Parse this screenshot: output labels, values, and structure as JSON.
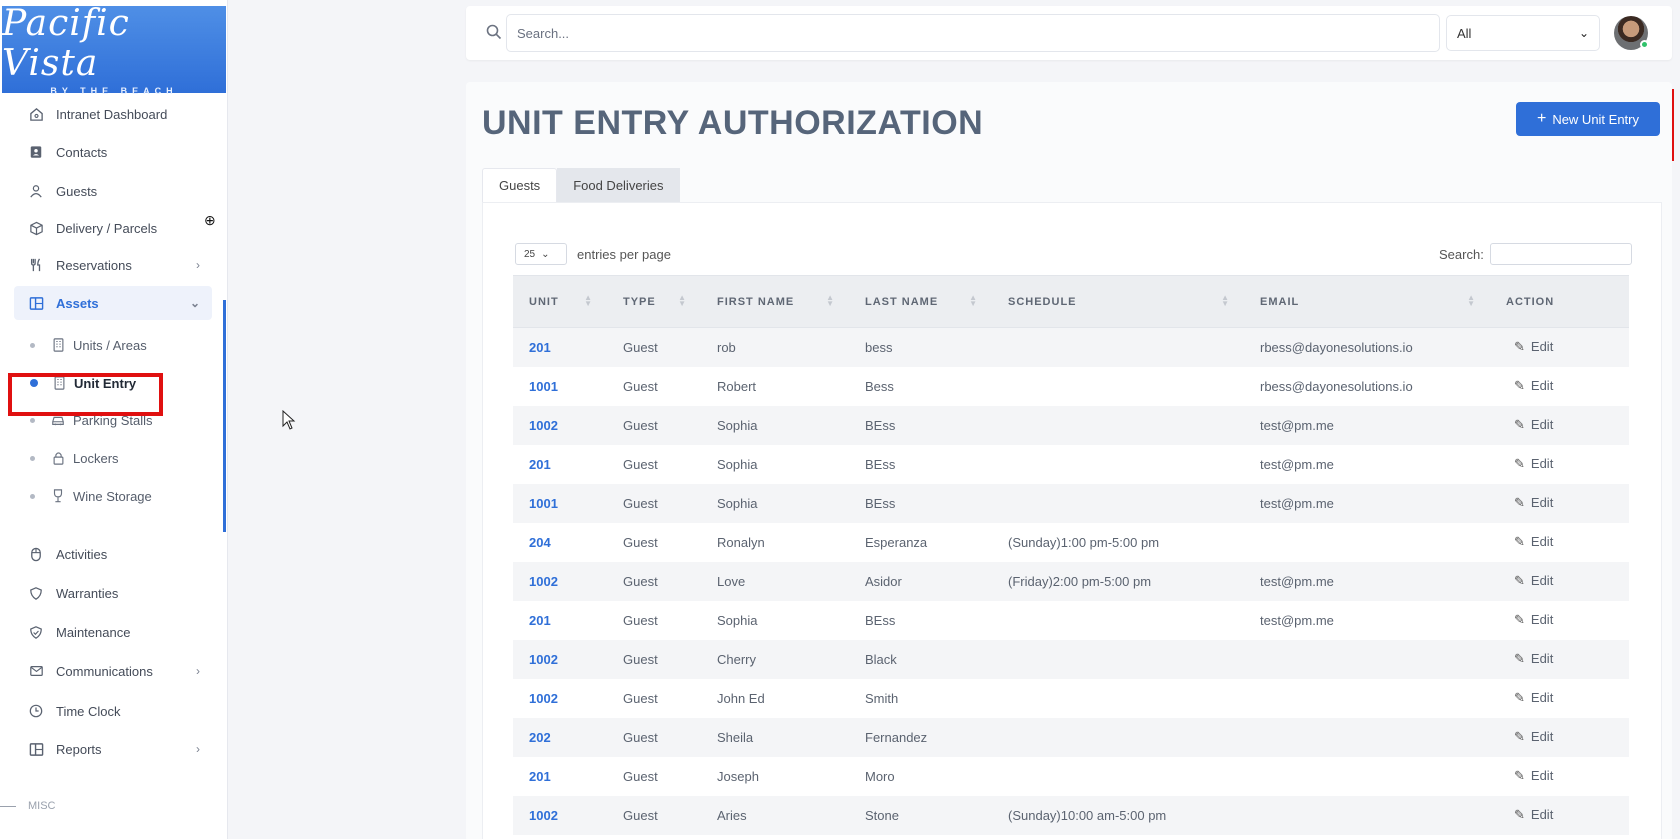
{
  "logo": {
    "script": "Pacific Vista",
    "tagline": "BY THE BEACH"
  },
  "sidebar": {
    "items": [
      {
        "label": "Intranet Dashboard",
        "icon": "home-icon"
      },
      {
        "label": "Contacts",
        "icon": "contacts-icon"
      },
      {
        "label": "Guests",
        "icon": "user-icon"
      },
      {
        "label": "Delivery / Parcels",
        "icon": "package-icon"
      },
      {
        "label": "Reservations",
        "icon": "utensils-icon",
        "chevron": "›"
      },
      {
        "label": "Assets",
        "icon": "layout-icon",
        "chevron": "⌄"
      }
    ],
    "sub_items": [
      {
        "label": "Units / Areas",
        "icon": "building-icon"
      },
      {
        "label": "Unit Entry",
        "icon": "building-icon"
      },
      {
        "label": "Parking Stalls",
        "icon": "car-icon"
      },
      {
        "label": "Lockers",
        "icon": "lock-icon"
      },
      {
        "label": "Wine Storage",
        "icon": "wine-icon"
      }
    ],
    "items_bottom": [
      {
        "label": "Activities",
        "icon": "mouse-icon"
      },
      {
        "label": "Warranties",
        "icon": "shield-icon"
      },
      {
        "label": "Maintenance",
        "icon": "shield-check-icon"
      },
      {
        "label": "Communications",
        "icon": "mail-icon",
        "chevron": "›"
      },
      {
        "label": "Time Clock",
        "icon": "clock-icon"
      },
      {
        "label": "Reports",
        "icon": "layout-icon",
        "chevron": "›"
      }
    ],
    "misc_label": "MISC"
  },
  "topbar": {
    "search_placeholder": "Search...",
    "scope_value": "All"
  },
  "page": {
    "title": "UNIT ENTRY AUTHORIZATION",
    "new_button": "New Unit Entry",
    "tabs": [
      "Guests",
      "Food Deliveries"
    ]
  },
  "table": {
    "length_value": "25",
    "length_label": "entries per page",
    "search_label": "Search:",
    "columns": [
      "UNIT",
      "TYPE",
      "FIRST NAME",
      "LAST NAME",
      "SCHEDULE",
      "EMAIL",
      "ACTION"
    ],
    "edit_label": "Edit",
    "rows": [
      [
        "201",
        "Guest",
        "rob",
        "bess",
        "",
        "rbess@dayonesolutions.io"
      ],
      [
        "1001",
        "Guest",
        "Robert",
        "Bess",
        "",
        "rbess@dayonesolutions.io"
      ],
      [
        "1002",
        "Guest",
        "Sophia",
        "BEss",
        "",
        "test@pm.me"
      ],
      [
        "201",
        "Guest",
        "Sophia",
        "BEss",
        "",
        "test@pm.me"
      ],
      [
        "1001",
        "Guest",
        "Sophia",
        "BEss",
        "",
        "test@pm.me"
      ],
      [
        "204",
        "Guest",
        "Ronalyn",
        "Esperanza",
        "(Sunday)1:00 pm-5:00 pm",
        ""
      ],
      [
        "1002",
        "Guest",
        "Love",
        "Asidor",
        "(Friday)2:00 pm-5:00 pm",
        "test@pm.me"
      ],
      [
        "201",
        "Guest",
        "Sophia",
        "BEss",
        "",
        "test@pm.me"
      ],
      [
        "1002",
        "Guest",
        "Cherry",
        "Black",
        "",
        ""
      ],
      [
        "1002",
        "Guest",
        "John Ed",
        "Smith",
        "",
        ""
      ],
      [
        "202",
        "Guest",
        "Sheila",
        "Fernandez",
        "",
        ""
      ],
      [
        "201",
        "Guest",
        "Joseph",
        "Moro",
        "",
        ""
      ],
      [
        "1002",
        "Guest",
        "Aries",
        "Stone",
        "(Sunday)10:00 am-5:00 pm",
        ""
      ]
    ]
  },
  "colors": {
    "accent": "#2f6fd8",
    "highlight": "#e01010",
    "status_online": "#31c26b"
  }
}
